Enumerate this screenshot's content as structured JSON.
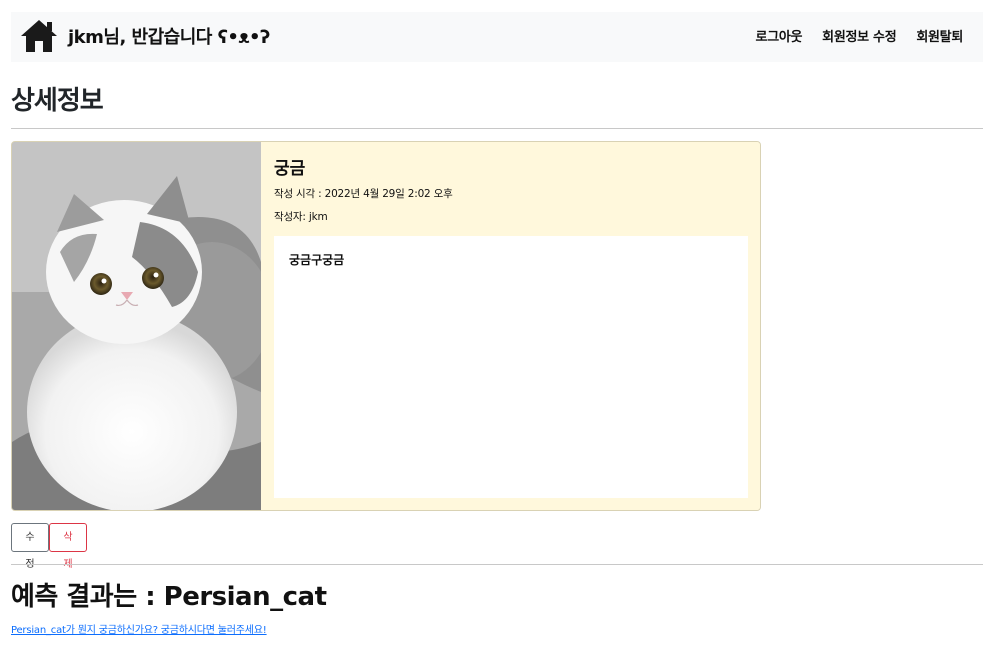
{
  "navbar": {
    "greeting": "jkm님, 반갑습니다 ʕ•ᴥ•ʔ",
    "links": [
      "로그아웃",
      "회원정보 수정",
      "회원탈퇴"
    ]
  },
  "page": {
    "title": "상세정보"
  },
  "post": {
    "title": "궁금",
    "created_label": "작성 시각 : 2022년 4월 29일 2:02 오후",
    "author_label": "작성자: jkm",
    "content": "궁금구궁금"
  },
  "actions": {
    "edit_label": "수정",
    "delete_label": "삭제"
  },
  "prediction": {
    "result_text": "예측 결과는 : Persian_cat",
    "link_text": "Persian_cat가 뭔지 궁금하신가요? 궁금하시다면 눌러주세요!"
  },
  "colors": {
    "card_background": "#fff8dc",
    "link": "#0d6efd",
    "delete": "#dc3545"
  }
}
